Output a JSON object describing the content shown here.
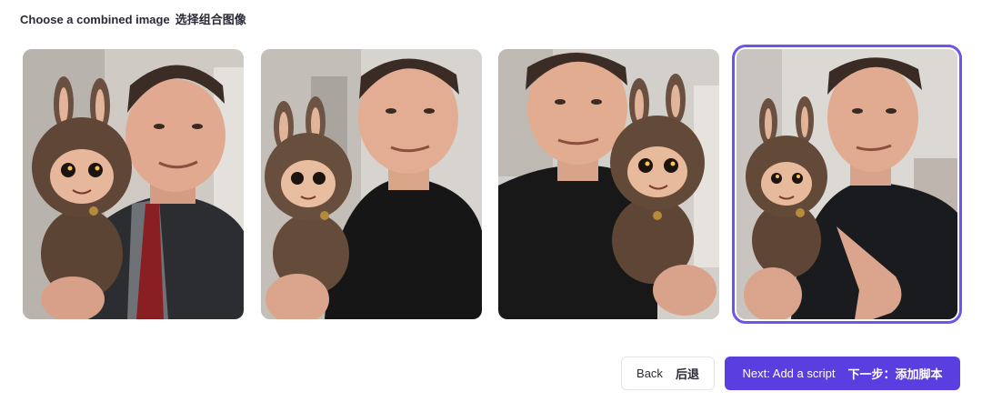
{
  "header": {
    "title_en": "Choose a combined image",
    "title_cn": "选择组合图像"
  },
  "images": [
    {
      "selected": false,
      "icon": "photo-man-suit-holding-plush-toy"
    },
    {
      "selected": false,
      "icon": "photo-man-black-shirt-holding-plush-toy"
    },
    {
      "selected": false,
      "icon": "photo-man-with-plush-toy-right"
    },
    {
      "selected": true,
      "icon": "photo-man-pointing-at-plush-toy"
    }
  ],
  "buttons": {
    "back_en": "Back",
    "back_cn": "后退",
    "next_en": "Next: Add a script",
    "next_cn": "下一步：添加脚本"
  },
  "colors": {
    "accent": "#5b3ee0",
    "selection_outline": "#6b55ea"
  }
}
